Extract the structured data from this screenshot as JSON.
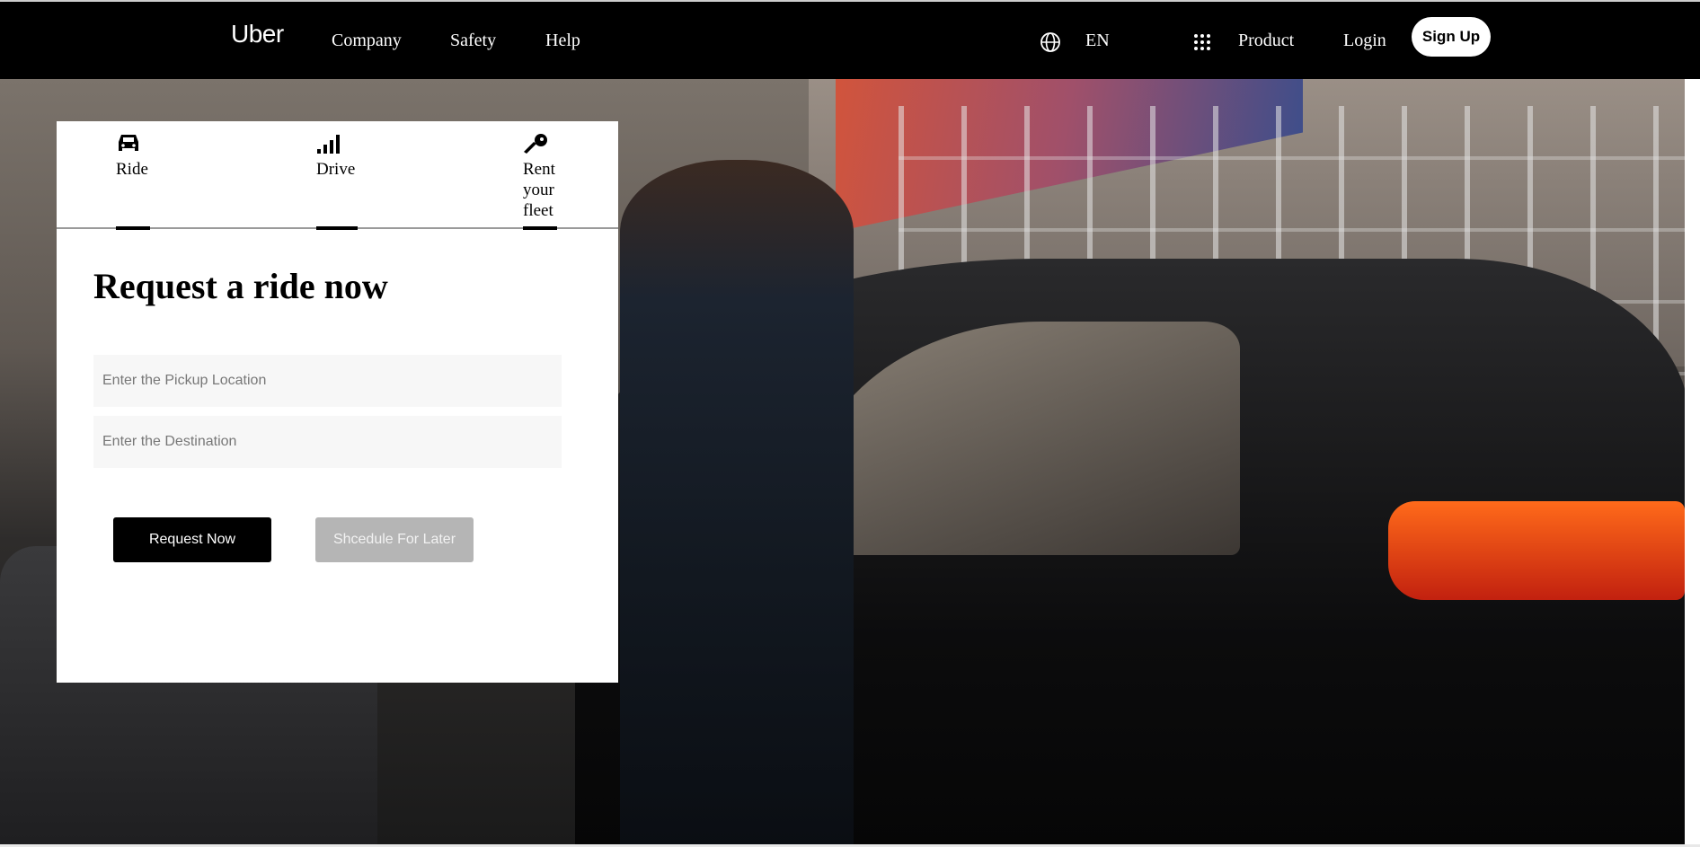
{
  "nav": {
    "logo": "Uber",
    "links": [
      "Company",
      "Safety",
      "Help"
    ],
    "language": "EN",
    "product": "Product",
    "login": "Login",
    "signup": "Sign Up"
  },
  "booking": {
    "tabs": [
      {
        "label": "Ride",
        "icon": "car-icon"
      },
      {
        "label": "Drive",
        "icon": "signal-bars-icon"
      },
      {
        "label": "Rent your fleet",
        "icon": "key-icon"
      }
    ],
    "heading": "Request a ride now",
    "pickup_placeholder": "Enter the Pickup Location",
    "destination_placeholder": "Enter the Destination",
    "request_label": "Request Now",
    "schedule_label": "Shcedule For Later"
  },
  "colors": {
    "nav_background": "#000000",
    "primary_button": "#000000",
    "secondary_button": "#b5b5b5",
    "input_background": "#f7f7f7"
  }
}
